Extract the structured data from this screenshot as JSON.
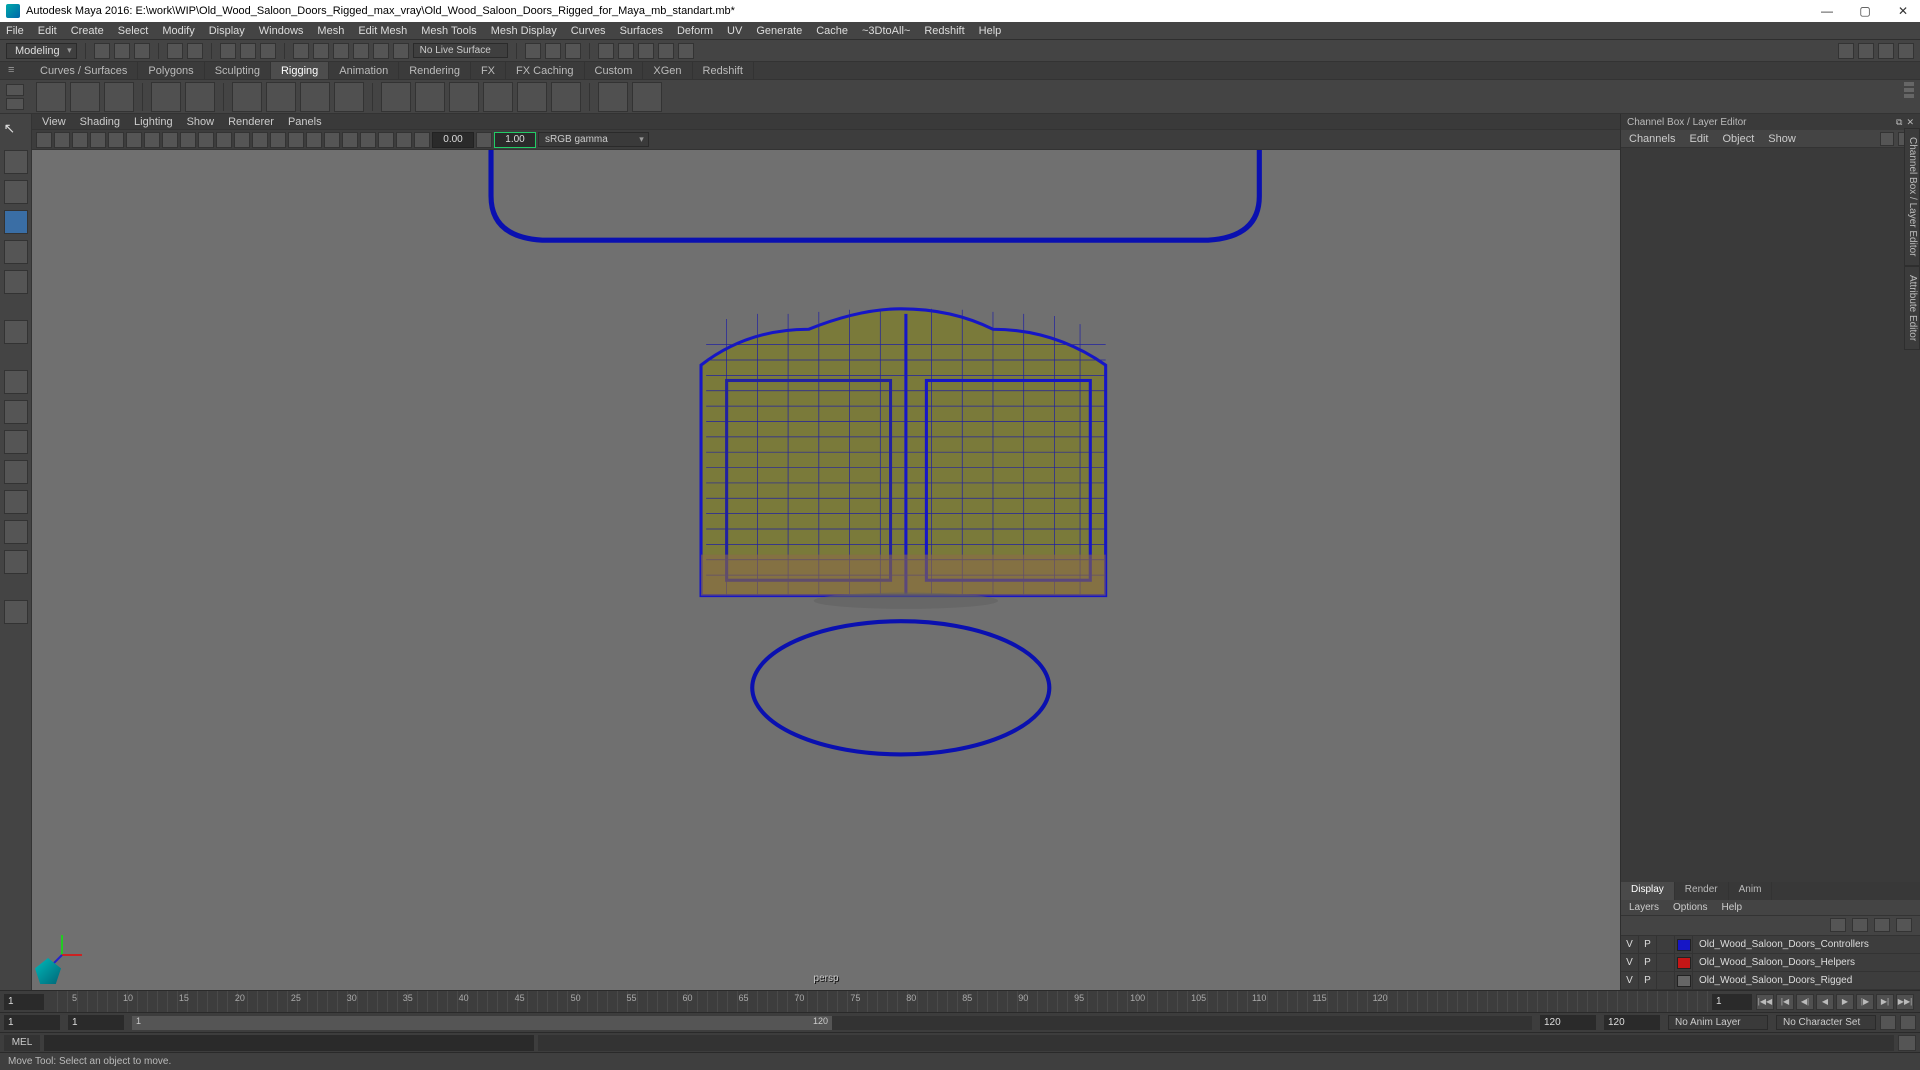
{
  "window": {
    "title": "Autodesk Maya 2016: E:\\work\\WIP\\Old_Wood_Saloon_Doors_Rigged_max_vray\\Old_Wood_Saloon_Doors_Rigged_for_Maya_mb_standart.mb*"
  },
  "menu": [
    "File",
    "Edit",
    "Create",
    "Select",
    "Modify",
    "Display",
    "Windows",
    "Mesh",
    "Edit Mesh",
    "Mesh Tools",
    "Mesh Display",
    "Curves",
    "Surfaces",
    "Deform",
    "UV",
    "Generate",
    "Cache",
    "~3DtoAll~",
    "Redshift",
    "Help"
  ],
  "workspace_mode": "Modeling",
  "no_live": "No Live Surface",
  "shelf_tabs": [
    "Curves / Surfaces",
    "Polygons",
    "Sculpting",
    "Rigging",
    "Animation",
    "Rendering",
    "FX",
    "FX Caching",
    "Custom",
    "XGen",
    "Redshift"
  ],
  "active_shelf_tab": 3,
  "panel_menu": [
    "View",
    "Shading",
    "Lighting",
    "Show",
    "Renderer",
    "Panels"
  ],
  "near_clip": "0.00",
  "far_clip": "1.00",
  "gamma": "sRGB gamma",
  "camera_label": "persp",
  "channelbox": {
    "title": "Channel Box / Layer Editor",
    "menus": [
      "Channels",
      "Edit",
      "Object",
      "Show"
    ],
    "display_tabs": [
      "Display",
      "Render",
      "Anim"
    ],
    "layer_menu": [
      "Layers",
      "Options",
      "Help"
    ],
    "layers": [
      {
        "v": "V",
        "p": "P",
        "color": "#1616c6",
        "name": "Old_Wood_Saloon_Doors_Controllers"
      },
      {
        "v": "V",
        "p": "P",
        "color": "#c61616",
        "name": "Old_Wood_Saloon_Doors_Helpers"
      },
      {
        "v": "V",
        "p": "P",
        "color": "#666",
        "name": "Old_Wood_Saloon_Doors_Rigged"
      }
    ]
  },
  "side_tabs": [
    "Channel Box / Layer Editor",
    "Attribute Editor"
  ],
  "time": {
    "start": "1",
    "end": "120",
    "range_start": "1",
    "range_end": "120",
    "current": "1",
    "ticks": [
      "5",
      "10",
      "15",
      "20",
      "25",
      "30",
      "35",
      "40",
      "45",
      "50",
      "55",
      "60",
      "65",
      "70",
      "75",
      "80",
      "85",
      "90",
      "95",
      "100",
      "105",
      "110",
      "115",
      "120"
    ]
  },
  "anim_layer": "No Anim Layer",
  "char_set": "No Character Set",
  "cmd_lang": "MEL",
  "help_text": "Move Tool: Select an object to move."
}
